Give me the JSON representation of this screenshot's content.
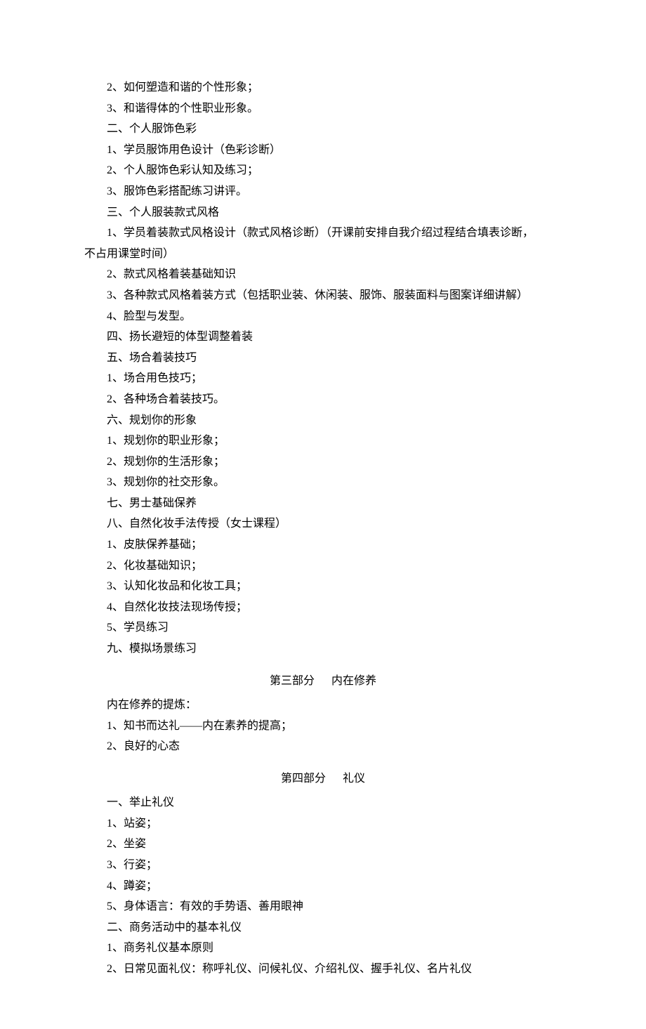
{
  "lines": {
    "l1": "2、如何塑造和谐的个性形象；",
    "l2": "3、和谐得体的个性职业形象。",
    "l3": "二、个人服饰色彩",
    "l4": "1、学员服饰用色设计（色彩诊断）",
    "l5": "2、个人服饰色彩认知及练习；",
    "l6": "3、服饰色彩搭配练习讲评。",
    "l7": "三、个人服装款式风格",
    "l8a": "1、学员着装款式风格设计（款式风格诊断）（开课前安排自我介绍过程结合填表诊断，",
    "l8b": "不占用课堂时间）",
    "l9": "2、款式风格着装基础知识",
    "l10": "3、各种款式风格着装方式（包括职业装、休闲装、服饰、服装面料与图案详细讲解）",
    "l11": "4、脸型与发型。",
    "l12": "四、扬长避短的体型调整着装",
    "l13": "五、场合着装技巧",
    "l14": "1、场合用色技巧；",
    "l15": "2、各种场合着装技巧。",
    "l16": "六、规划你的形象",
    "l17": "1、规划你的职业形象；",
    "l18": "2、规划你的生活形象；",
    "l19": "3、规划你的社交形象。",
    "l20": "七、男士基础保养",
    "l21": "八、自然化妆手法传授（女士课程）",
    "l22": "1、皮肤保养基础；",
    "l23": "2、化妆基础知识；",
    "l24": "3、认知化妆品和化妆工具；",
    "l25": "4、自然化妆技法现场传授；",
    "l26": "5、学员练习",
    "l27": "九、模拟场景练习"
  },
  "section3": {
    "part": "第三部分",
    "title": "内在修养",
    "l1": "内在修养的提炼：",
    "l2": "1、知书而达礼——内在素养的提高；",
    "l3": "2、良好的心态"
  },
  "section4": {
    "part": "第四部分",
    "title": "礼仪",
    "l1": "一、举止礼仪",
    "l2": "1、站姿；",
    "l3": "2、坐姿",
    "l4": "3、行姿；",
    "l5": "4、蹲姿；",
    "l6": "5、身体语言：有效的手势语、善用眼神",
    "l7": "二、商务活动中的基本礼仪",
    "l8": "1、商务礼仪基本原则",
    "l9": "2、日常见面礼仪：称呼礼仪、问候礼仪、介绍礼仪、握手礼仪、名片礼仪"
  }
}
